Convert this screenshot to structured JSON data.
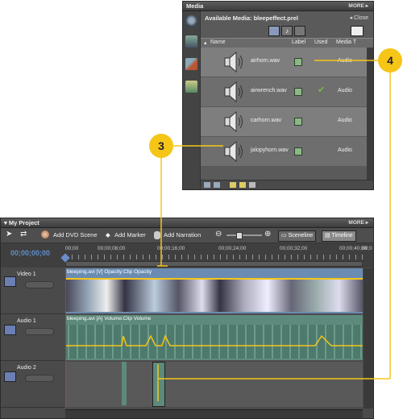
{
  "media_panel": {
    "title": "Media",
    "more": "MORE",
    "available_label": "Available Media: bleepeffect.prel",
    "close_label": "Close",
    "columns": [
      "Name",
      "Label",
      "Used",
      "Media T"
    ],
    "items": [
      {
        "name": "airhorn.wav",
        "type": "Audio",
        "used": false
      },
      {
        "name": "airwrench.wav",
        "type": "Audio",
        "used": true
      },
      {
        "name": "carhorn.wav",
        "type": "Audio",
        "used": false
      },
      {
        "name": "jalopyhorn.wav",
        "type": "Audio",
        "used": false
      }
    ]
  },
  "project_panel": {
    "title": "My Project",
    "more": "MORE",
    "toolbar": {
      "add_dvd_scene": "Add DVD Scene",
      "add_marker": "Add Marker",
      "add_narration": "Add Narration",
      "sceneline": "Sceneline",
      "timeline": "Timeline"
    },
    "timecode": "00;00;00;00",
    "ruler_ticks": [
      "00;00",
      "00;00;08;00",
      "00;00;16;00",
      "00;00;24;00",
      "00;00;32;00",
      "00;00;40;00",
      "00;0"
    ],
    "tracks": [
      {
        "name": "Video 1",
        "clip_label": "bleeping.avi [V] Opacity:Clip Opacity"
      },
      {
        "name": "Audio 1",
        "clip_label": "bleeping.avi [A] Volume:Clip Volume"
      },
      {
        "name": "Audio 2",
        "clip_label": ""
      }
    ]
  },
  "callouts": {
    "c3": "3",
    "c4": "4"
  },
  "colors": {
    "callout": "#f5c518",
    "timecode": "#5f8ec8",
    "playhead": "#d03030"
  }
}
